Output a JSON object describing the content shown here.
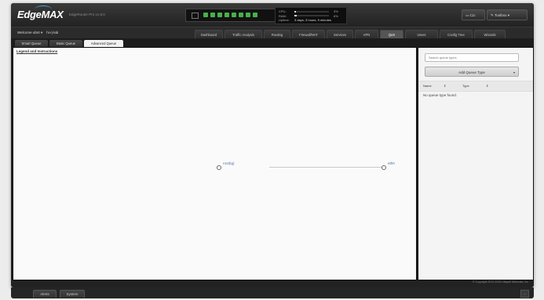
{
  "header": {
    "logo": "EdgeMAX",
    "model": "EdgeRouter Pro v1.8.0",
    "cli_label": "CLI",
    "toolbox_label": "Toolbox",
    "stats": {
      "cpu_label": "CPU:",
      "cpu_value": "3%",
      "cpu_fill": 0.04,
      "ram_label": "RAM:",
      "ram_value": "6%",
      "ram_fill": 0.07,
      "uptime_label": "Uptime:",
      "uptime_value": "3 days, 3 hours, 9 minutes"
    }
  },
  "navbar": {
    "welcome": "Welcome ubnt",
    "hostname": "hi-rj-lab",
    "tabs": [
      "Dashboard",
      "Traffic Analysis",
      "Routing",
      "Firewall/NAT",
      "Services",
      "VPN",
      "QoS",
      "Users",
      "Config Tree",
      "Wizards"
    ],
    "active_tab": "QoS"
  },
  "subtabs": {
    "items": [
      "Smart Queue",
      "Basic Queue",
      "Advanced Queue"
    ],
    "active": "Advanced Queue"
  },
  "canvas": {
    "legend_link": "Legend and Instructions",
    "nodes": [
      {
        "label": "root(Ig)"
      },
      {
        "label": "eth0"
      }
    ]
  },
  "panel": {
    "search_placeholder": "Search queue types",
    "add_button": "Add Queue Type",
    "col_name": "Name",
    "col_type": "Type",
    "empty_text": "No queue type found."
  },
  "footer": {
    "copyright": "© Copyright 2012-2015 Ubiquiti Networks, Inc.",
    "tabs": [
      "Alerts",
      "System"
    ]
  },
  "colors": {
    "accent": "#47b04b",
    "link_blue": "#4a6fa5"
  }
}
